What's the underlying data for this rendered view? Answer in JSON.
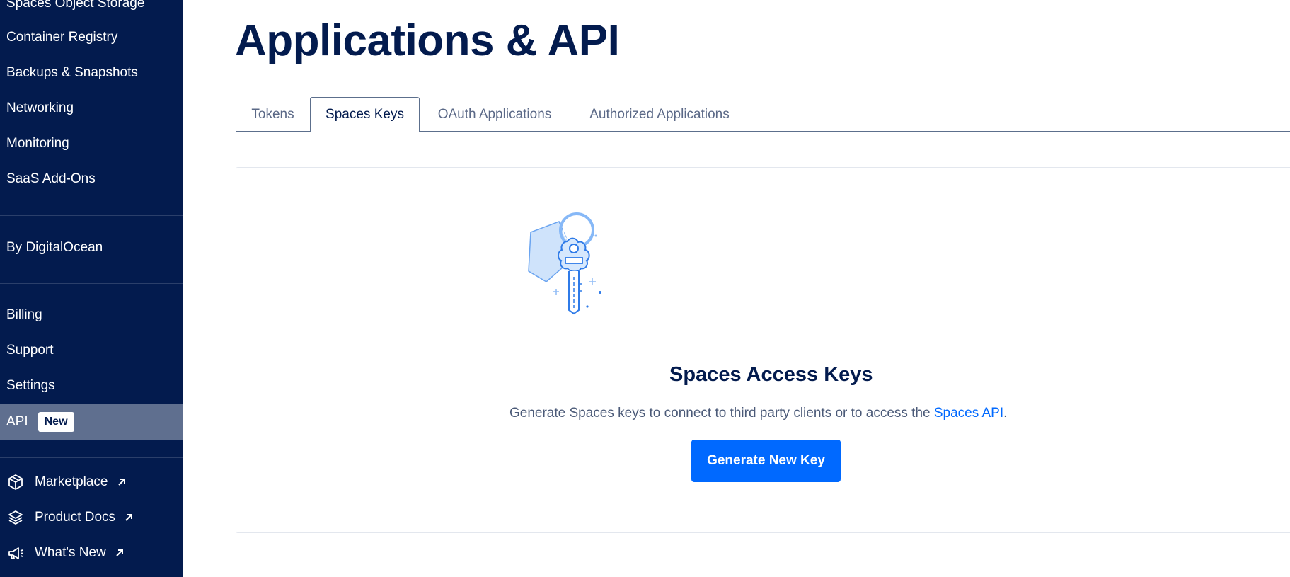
{
  "sidebar": {
    "items": [
      {
        "label": "Spaces Object Storage"
      },
      {
        "label": "Container Registry"
      },
      {
        "label": "Backups & Snapshots"
      },
      {
        "label": "Networking"
      },
      {
        "label": "Monitoring"
      },
      {
        "label": "SaaS Add-Ons"
      }
    ],
    "by_label": "By DigitalOcean",
    "account_items": [
      {
        "label": "Billing"
      },
      {
        "label": "Support"
      },
      {
        "label": "Settings"
      }
    ],
    "api": {
      "label": "API",
      "badge": "New"
    },
    "external_items": [
      {
        "label": "Marketplace",
        "icon": "marketplace-cube-icon"
      },
      {
        "label": "Product Docs",
        "icon": "layers-icon"
      },
      {
        "label": "What's New",
        "icon": "megaphone-icon"
      }
    ]
  },
  "main": {
    "title": "Applications & API",
    "tabs": [
      {
        "label": "Tokens"
      },
      {
        "label": "Spaces Keys",
        "active": true
      },
      {
        "label": "OAuth Applications"
      },
      {
        "label": "Authorized Applications"
      }
    ],
    "empty_state": {
      "illustration": "key-icon",
      "heading": "Spaces Access Keys",
      "description_prefix": "Generate Spaces keys to connect to third party clients or to access the ",
      "link_text": "Spaces API",
      "description_suffix": ".",
      "button_label": "Generate New Key"
    }
  },
  "colors": {
    "sidebar_bg": "#031b4e",
    "active_item_bg": "#5f6f8f",
    "primary_button": "#0069ff",
    "title": "#031b4e"
  }
}
